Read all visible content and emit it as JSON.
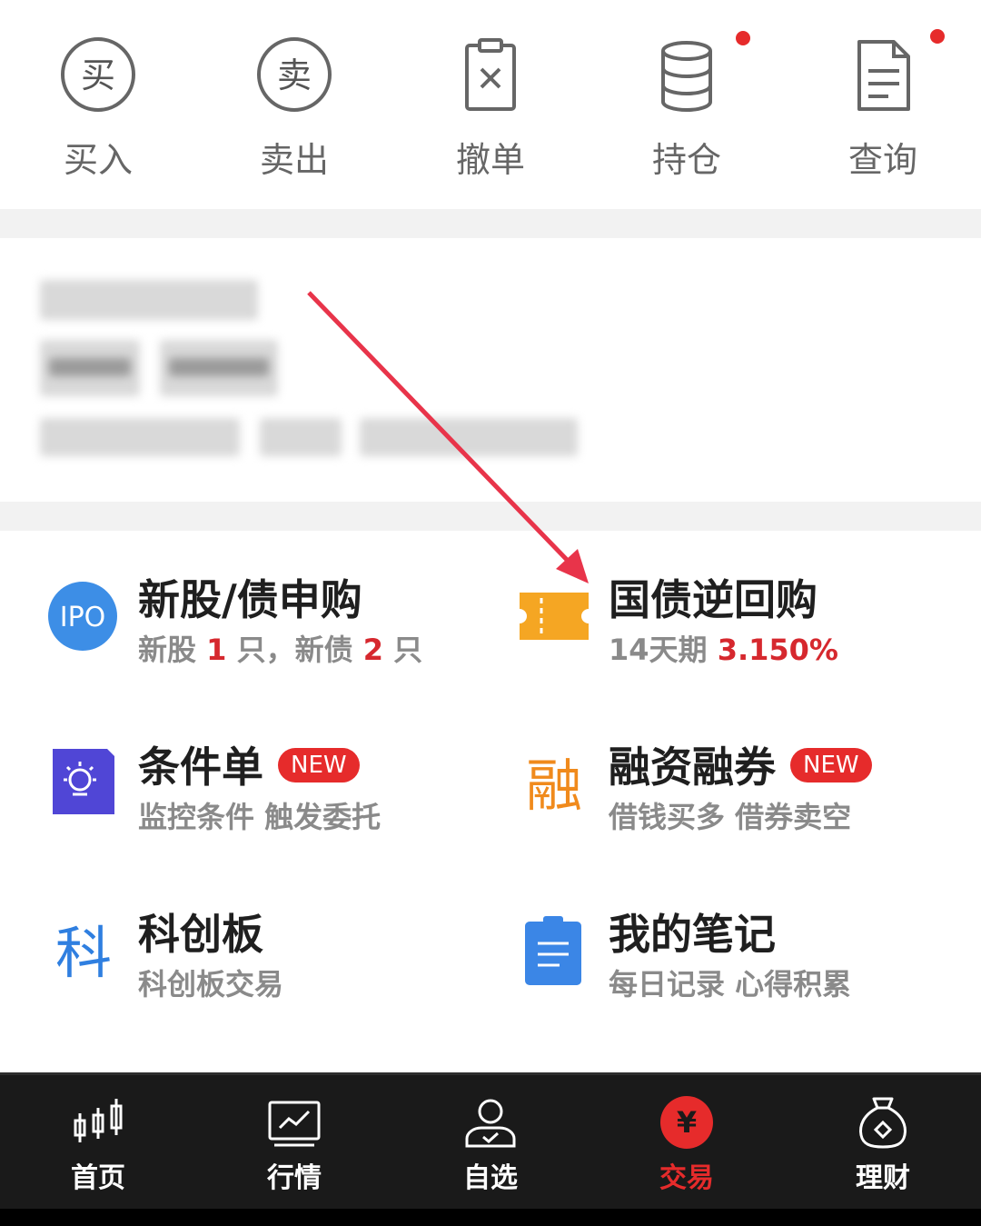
{
  "quick_actions": [
    {
      "label": "买入",
      "icon": "buy-circle-icon",
      "glyph": "买"
    },
    {
      "label": "卖出",
      "icon": "sell-circle-icon",
      "glyph": "卖"
    },
    {
      "label": "撤单",
      "icon": "cancel-order-icon"
    },
    {
      "label": "持仓",
      "icon": "database-icon"
    },
    {
      "label": "查询",
      "icon": "document-icon"
    }
  ],
  "services": {
    "ipo": {
      "title": "新股/债申购",
      "icon_text": "IPO",
      "sub_pre": "新股 ",
      "stock_count": "1",
      "sub_mid": " 只，新债 ",
      "bond_count": "2",
      "sub_post": " 只"
    },
    "repo": {
      "title": "国债逆回购",
      "sub_pre": "14天期 ",
      "rate": "3.150%"
    },
    "condition": {
      "title": "条件单",
      "badge": "NEW",
      "sub": "监控条件 触发委托"
    },
    "margin": {
      "title": "融资融券",
      "badge": "NEW",
      "icon_text": "融",
      "sub": "借钱买多 借券卖空"
    },
    "star": {
      "title": "科创板",
      "icon_text": "科",
      "sub": "科创板交易"
    },
    "notes": {
      "title": "我的笔记",
      "sub": "每日记录 心得积累"
    }
  },
  "bottom_nav": [
    {
      "label": "首页",
      "icon": "candlestick-icon"
    },
    {
      "label": "行情",
      "icon": "market-chart-icon"
    },
    {
      "label": "自选",
      "icon": "user-check-icon"
    },
    {
      "label": "交易",
      "icon": "yuan-icon",
      "glyph": "¥",
      "active": true
    },
    {
      "label": "理财",
      "icon": "money-bag-icon"
    }
  ],
  "colors": {
    "accent": "#e62b2b",
    "ipo_blue": "#3d8ee6",
    "repo_orange": "#f5a623",
    "condition_purple": "#5046d6",
    "star_blue": "#2f7fe0",
    "notes_blue": "#3b86e6",
    "margin_orange": "#f08a1c"
  }
}
